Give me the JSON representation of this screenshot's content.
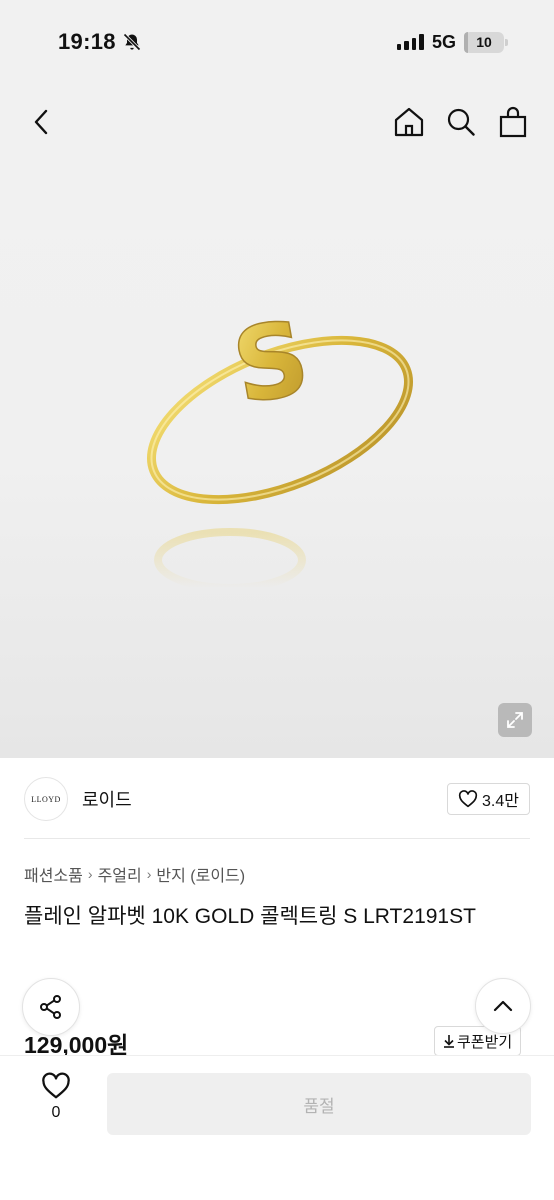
{
  "status_bar": {
    "time": "19:18",
    "network": "5G",
    "battery": "10",
    "battery_level": 0.1
  },
  "seller": {
    "logo_text": "LLOYD",
    "name": "로이드",
    "like_count": "3.4만"
  },
  "breadcrumb": [
    "패션소품",
    "주얼리",
    "반지 (로이드)"
  ],
  "product": {
    "title": "플레인 알파벳 10K GOLD 콜렉트링 S LRT2191ST",
    "price": "129,000원"
  },
  "coupon": {
    "label": "쿠폰받기"
  },
  "wishlist": {
    "count": "0"
  },
  "buy_button": {
    "label": "품절"
  },
  "colors": {
    "gold": "#e2c14a",
    "soldout_bg": "#efefef",
    "soldout_text": "#b3b3b3"
  },
  "icons": {
    "back": "chevron-left-icon",
    "home": "home-icon",
    "search": "search-icon",
    "bag": "shopping-bag-icon",
    "expand": "expand-icon",
    "share": "share-icon",
    "top": "chevron-up-icon",
    "heart": "heart-icon",
    "download": "download-icon"
  }
}
